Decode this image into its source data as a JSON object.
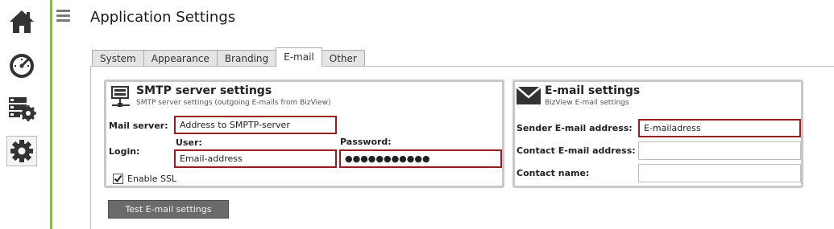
{
  "page": {
    "title": "Application Settings"
  },
  "sidebar": {
    "items": [
      {
        "icon": "home-icon"
      },
      {
        "icon": "gauge-icon"
      },
      {
        "icon": "server-settings-icon"
      },
      {
        "icon": "gear-icon",
        "active": true
      }
    ],
    "accent_color": "#8dbb3c"
  },
  "tabs": [
    {
      "label": "System"
    },
    {
      "label": "Appearance"
    },
    {
      "label": "Branding"
    },
    {
      "label": "E-mail",
      "active": true
    },
    {
      "label": "Other"
    }
  ],
  "smtp": {
    "title": "SMTP server settings",
    "subtitle": "SMTP server settings (outgoing E-mails from BizView)",
    "mail_server_label": "Mail server:",
    "mail_server_value": "Address to SMPTP-server",
    "login_label": "Login:",
    "user_label": "User:",
    "user_value": "Email-address",
    "password_label": "Password:",
    "password_value": "●●●●●●●●●●●",
    "ssl_label": "Enable SSL",
    "ssl_checked": true
  },
  "email": {
    "title": "E-mail settings",
    "subtitle": "BizView E-mail settings",
    "sender_label": "Sender E-mail address:",
    "sender_value": "E-mailadress",
    "contact_label": "Contact E-mail address:",
    "contact_value": "",
    "contact_name_label": "Contact name:",
    "contact_name_value": ""
  },
  "test_button": {
    "label": "Test E-mail settings"
  },
  "colors": {
    "required_border": "#9b1c1c",
    "group_border": "#c8c8c8",
    "button_bg": "#6b6b6b"
  }
}
